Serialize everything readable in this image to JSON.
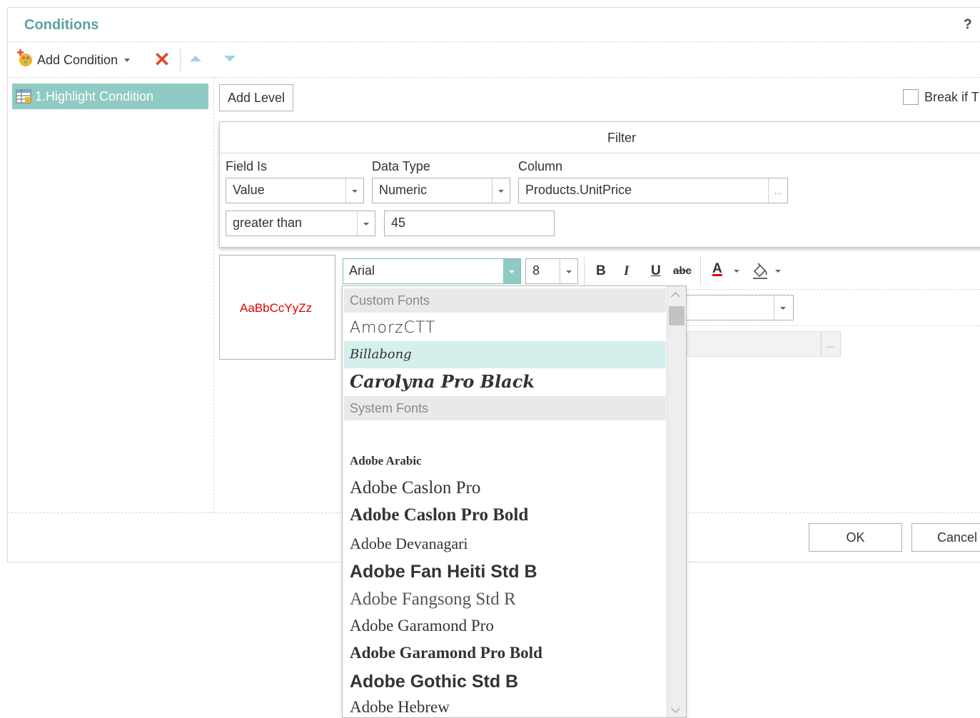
{
  "dialog": {
    "title": "Conditions",
    "help_label": "?"
  },
  "toolbar": {
    "add_condition_label": "Add Condition",
    "delete_glyph": "✕"
  },
  "conditions_list": [
    {
      "label": "1.Highlight Condition"
    }
  ],
  "main": {
    "add_level_label": "Add Level",
    "break_label": "Break if T"
  },
  "filter": {
    "title": "Filter",
    "field_is_label": "Field Is",
    "field_is_value": "Value",
    "data_type_label": "Data Type",
    "data_type_value": "Numeric",
    "column_label": "Column",
    "column_value": "Products.UnitPrice",
    "column_button": "...",
    "operator_value": "greater than",
    "operand_value": "45"
  },
  "style": {
    "preview_text": "AaBbCcYyZz",
    "preview_color": "#e00000",
    "font_value": "Arial",
    "size_value": "8",
    "bold_label": "B",
    "italic_label": "I",
    "underline_label": "U",
    "strike_label": "abc",
    "font_color_label": "A",
    "font_color": "#e00000",
    "hidden_column_button": "..."
  },
  "font_list": {
    "custom_group": "Custom Fonts",
    "system_group": "System Fonts",
    "custom_fonts": [
      "AmorzCTT",
      "Billabong",
      "Carolyna Pro Black"
    ],
    "selected_font": "Billabong",
    "system_fonts": [
      "Adobe Arabic",
      "Adobe Caslon Pro",
      "Adobe Caslon Pro Bold",
      "Adobe Devanagari",
      "Adobe Fan Heiti Std B",
      "Adobe Fangsong Std R",
      "Adobe Garamond Pro",
      "Adobe Garamond Pro Bold",
      "Adobe Gothic Std B",
      "Adobe Hebrew"
    ]
  },
  "footer": {
    "ok_label": "OK",
    "cancel_label": "Cancel"
  },
  "colors": {
    "accent": "#8fcac4",
    "title": "#5ba3a0",
    "delete": "#e04a2f",
    "arrows": "#9fd0ea"
  }
}
